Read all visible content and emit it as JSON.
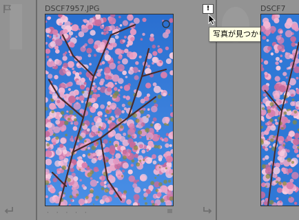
{
  "cells": [
    {
      "filename": "",
      "index_bg": ""
    },
    {
      "filename": "DSCF7957.JPG",
      "index_bg": ""
    },
    {
      "filename": "DSCF7",
      "index_bg": ""
    }
  ],
  "tooltip": {
    "text": "写真が見つかりません"
  },
  "badge": {
    "label": "!"
  },
  "rating_dots": "· · · · ·",
  "icons": {
    "flag": "flag-icon",
    "rotate_left": "rotate-left-icon",
    "rotate_right": "rotate-right-icon",
    "quick_collection": "circle-marker-icon",
    "cursor": "mouse-cursor-icon"
  },
  "colors": {
    "background": "#8c8c8c",
    "cell": "#939393",
    "separator": "#6b6b6b",
    "tooltip_bg": "#ffffe1",
    "sky": "#2f78d6",
    "blossom": "#e79ac1"
  }
}
